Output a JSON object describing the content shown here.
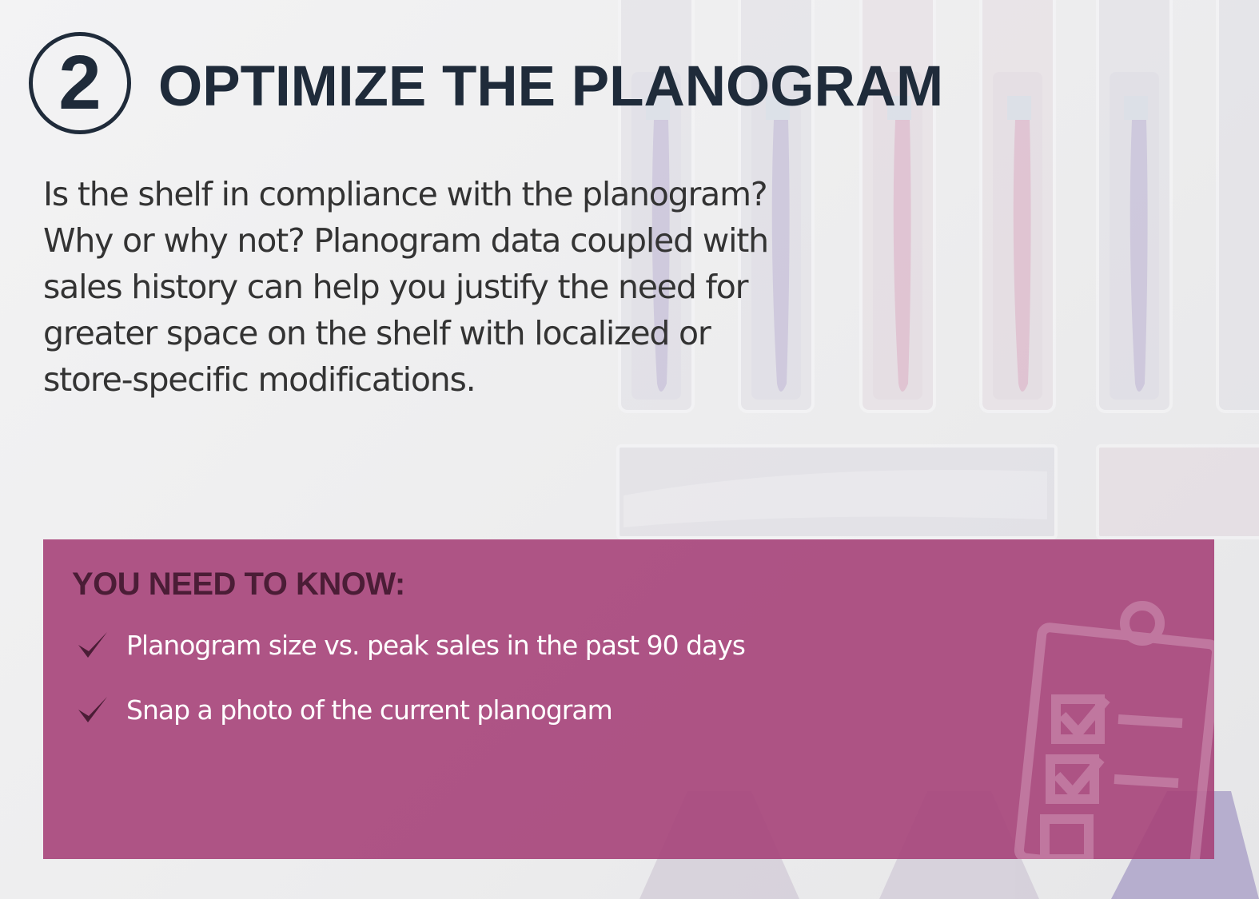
{
  "header": {
    "step_number": "2",
    "title": "OPTIMIZE THE PLANOGRAM"
  },
  "intro": {
    "lines": [
      "Is the shelf in compliance with the planogram?",
      "Why or why not? Planogram data coupled with",
      "sales history can help you justify the need for",
      "greater space on the shelf with localized or",
      "store-specific modifications."
    ]
  },
  "know_box": {
    "title": "YOU NEED TO KNOW:",
    "items": [
      "Planogram size vs. peak sales in the past 90 days",
      "Snap a photo of the current planogram"
    ]
  },
  "colors": {
    "title": "#1f2b3a",
    "body_text": "#333333",
    "box": "#a64279",
    "box_title": "#4b1d36",
    "box_text": "#ffffff"
  },
  "icons": {
    "step": "numbered-circle-icon",
    "bullet": "checkmark-icon",
    "background": "toothbrush-packages-illustration",
    "clipboard": "clipboard-checklist-icon"
  }
}
